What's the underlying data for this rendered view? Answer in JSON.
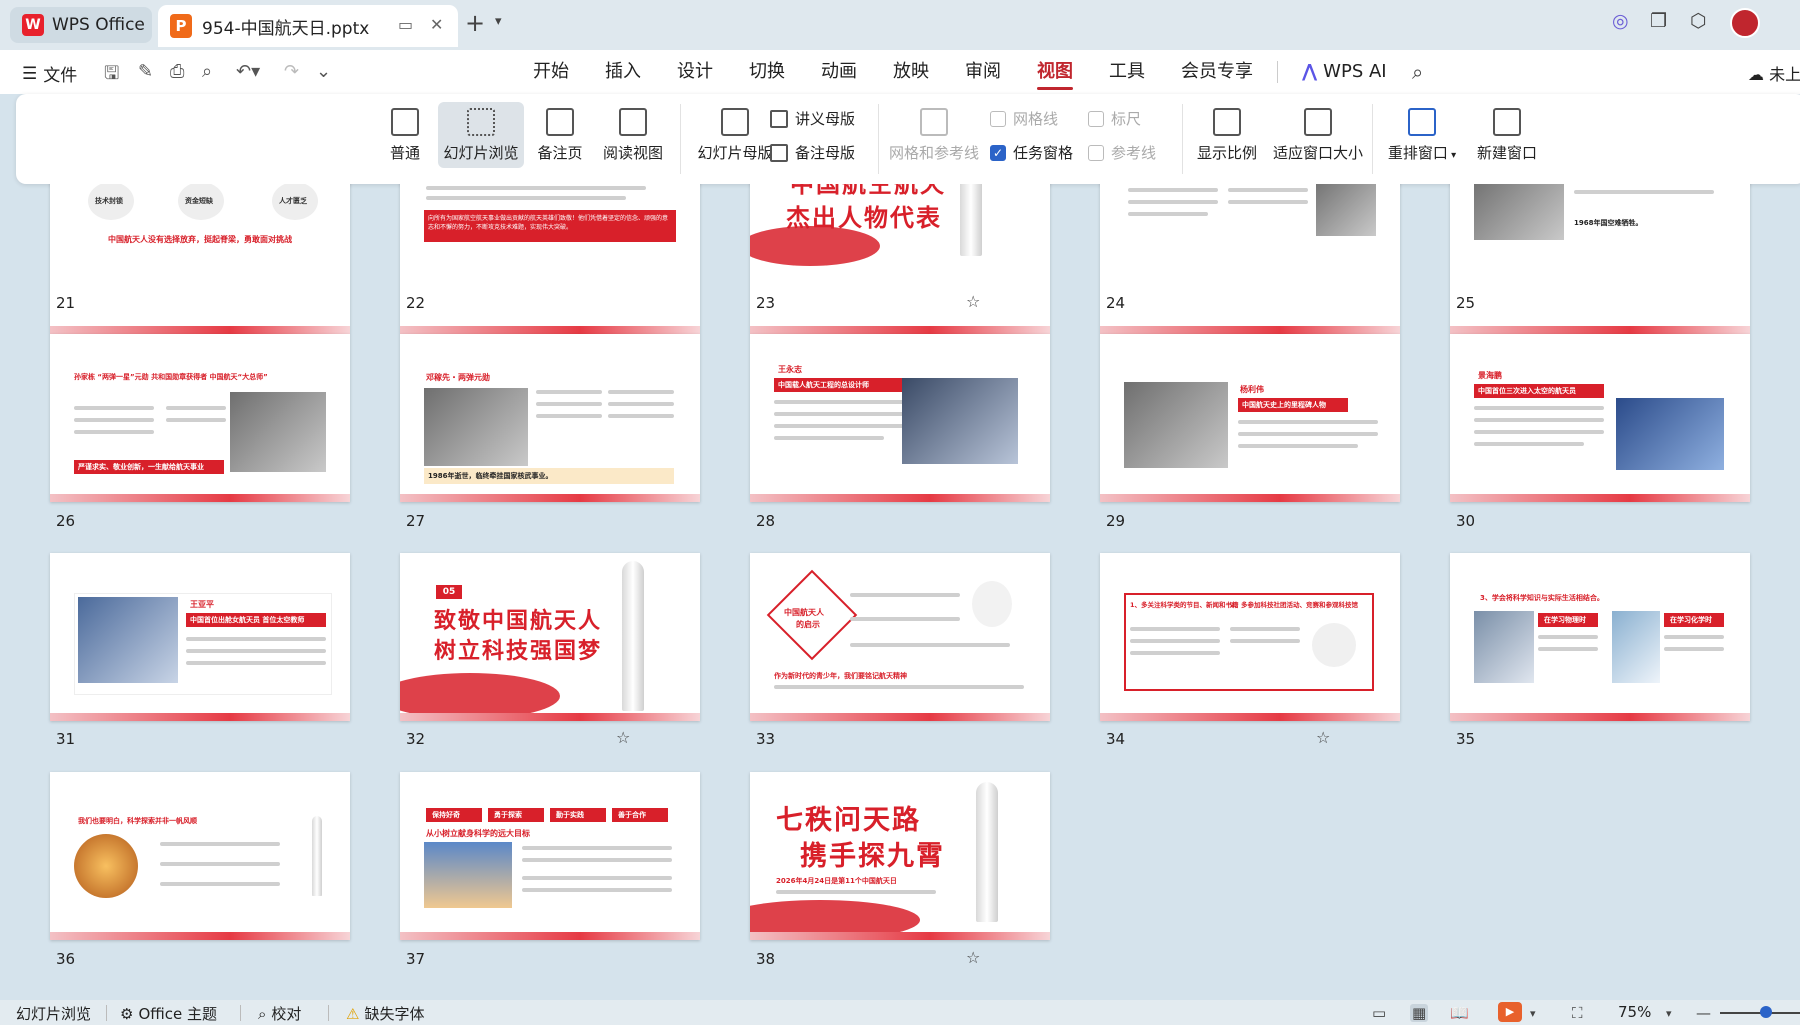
{
  "tabs": {
    "home": "WPS Office",
    "document": "954-中国航天日.pptx"
  },
  "menu": {
    "file": "文件",
    "items": [
      "开始",
      "插入",
      "设计",
      "切换",
      "动画",
      "放映",
      "审阅",
      "视图",
      "工具",
      "会员专享"
    ],
    "active": "视图",
    "ai": "WPS AI",
    "cloud": "未上"
  },
  "ribbon": {
    "normal": "普通",
    "slide_sorter": "幻灯片浏览",
    "notes_page": "备注页",
    "reading_view": "阅读视图",
    "slide_master": "幻灯片母版",
    "handout_master": "讲义母版",
    "notes_master": "备注母版",
    "grid_guides": "网格和参考线",
    "gridlines": "网格线",
    "ruler": "标尺",
    "task_pane": "任务窗格",
    "guides": "参考线",
    "zoom": "显示比例",
    "fit_window": "适应窗口大小",
    "arrange": "重排窗口",
    "new_window": "新建窗口"
  },
  "slides": {
    "s21": {
      "num": "21",
      "t1": "技术封锁",
      "t2": "资金短缺",
      "t3": "人才匮乏",
      "caption": "中国航天人没有选择放弃，挺起脊梁，勇敢面对挑战"
    },
    "s22": {
      "num": "22",
      "text": "向所有为国家航空航天事业做出贡献的航天英雄们致敬！他们凭借着坚定的信念、顽强的意志和不懈的努力，不断攻克技术难题，实现伟大突破。"
    },
    "s23": {
      "num": "23",
      "title1": "中国航空航天",
      "title2": "杰出人物代表"
    },
    "s24": {
      "num": "24"
    },
    "s25": {
      "num": "25",
      "tag": "1968年国空难牺牲。"
    },
    "s26": {
      "num": "26",
      "head": "孙家栋 “两弹一星”元勋 共和国勋章获得者 中国航天“大总师”",
      "foot": "严谨求实、敬业创新，一生献给航天事业"
    },
    "s27": {
      "num": "27",
      "head": "邓稼先・两弹元勋",
      "foot": "1986年逝世，临终牵挂国家核武事业。"
    },
    "s28": {
      "num": "28",
      "head": "王永志",
      "bar": "中国载人航天工程的总设计师"
    },
    "s29": {
      "num": "29",
      "head": "杨利伟",
      "bar": "中国航天史上的里程碑人物"
    },
    "s30": {
      "num": "30",
      "head": "景海鹏",
      "bar": "中国首位三次进入太空的航天员"
    },
    "s31": {
      "num": "31",
      "head": "王亚平",
      "bar": "中国首位出舱女航天员 首位太空教师"
    },
    "s32": {
      "num": "32",
      "badge": "05",
      "title1": "致敬中国航天人",
      "title2": "树立科技强国梦"
    },
    "s33": {
      "num": "33",
      "diamond1": "中国航天人",
      "diamond2": "的启示",
      "foot": "作为新时代的青少年，我们要铭记航天精神"
    },
    "s34": {
      "num": "34",
      "h1": "1、多关注科学类的节目、新闻和书籍",
      "h2": "2、多参加科技社团活动、竞赛和参观科技馆"
    },
    "s35": {
      "num": "35",
      "head": "3、学会将科学知识与实际生活相结合。",
      "b1": "在学习物理时",
      "b2": "在学习化学时"
    },
    "s36": {
      "num": "36",
      "head": "我们也要明白，科学探索并非一帆风顺"
    },
    "s37": {
      "num": "37",
      "b1": "保持好奇",
      "b2": "勇于探索",
      "b3": "勤于实践",
      "b4": "善于合作",
      "head": "从小树立献身科学的远大目标"
    },
    "s38": {
      "num": "38",
      "title1": "七秩问天路",
      "title2": "携手探九霄",
      "sub": "2026年4月24日是第11个中国航天日"
    }
  },
  "statusbar": {
    "view": "幻灯片浏览",
    "theme": "Office 主题",
    "proof": "校对",
    "missing_font": "缺失字体",
    "zoom": "75%"
  },
  "colors": {
    "accent": "#c0262e",
    "slide_red": "#d8202a",
    "background": "#d5e3ec"
  }
}
